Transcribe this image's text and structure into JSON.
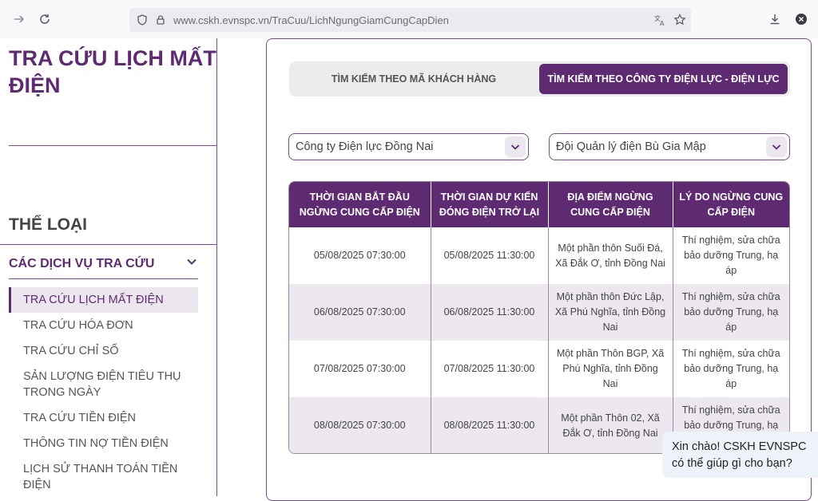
{
  "browser": {
    "url": "www.cskh.evnspc.vn/TraCuu/LichNgungGiamCungCapDien"
  },
  "page": {
    "title": "TRA CỨU LỊCH MẤT ĐIỆN",
    "category_title": "THỂ LOẠI",
    "services_title": "CÁC DỊCH VỤ TRA CỨU"
  },
  "menu": {
    "items": [
      {
        "label": "TRA CỨU LỊCH MẤT ĐIỆN",
        "active": true
      },
      {
        "label": "TRA CỨU HÓA ĐƠN"
      },
      {
        "label": "TRA CỨU CHỈ SỐ"
      },
      {
        "label": "SẢN LƯỢNG ĐIỆN TIÊU THỤ TRONG NGÀY"
      },
      {
        "label": "TRA CỨU TIỀN ĐIỆN"
      },
      {
        "label": "THÔNG TIN NỢ TIỀN ĐIỆN"
      },
      {
        "label": "LỊCH SỬ THANH TOÁN TIỀN ĐIỆN"
      }
    ]
  },
  "tabs": {
    "by_customer": "TÌM KIẾM THEO MÃ KHÁCH HÀNG",
    "by_company": "TÌM KIẾM THEO CÔNG TY ĐIỆN LỰC - ĐIỆN LỰC"
  },
  "filters": {
    "company": "Công ty Điện lực Đồng Nai",
    "unit": "Đội Quản lý điện Bù Gia Mập"
  },
  "table": {
    "headers": [
      "THỜI GIAN BẮT ĐẦU NGỪNG CUNG CẤP ĐIỆN",
      "THỜI GIAN DỰ KIẾN ĐÓNG ĐIỆN TRỞ LẠI",
      "ĐỊA ĐIỂM NGỪNG CUNG CẤP ĐIỆN",
      "LÝ DO NGỪNG CUNG CẤP ĐIỆN"
    ],
    "rows": [
      [
        "05/08/2025 07:30:00",
        "05/08/2025 11:30:00",
        "Một phần thôn Suối Đá, Xã Đắk Ơ, tỉnh Đồng Nai",
        "Thí nghiệm, sửa chữa bảo dưỡng Trung, hạ áp"
      ],
      [
        "06/08/2025 07:30:00",
        "06/08/2025 11:30:00",
        "Một phần thôn Đức Lập, Xã Phú Nghĩa, tỉnh Đồng Nai",
        "Thí nghiệm, sửa chữa bảo dưỡng Trung, hạ áp"
      ],
      [
        "07/08/2025 07:30:00",
        "07/08/2025 11:30:00",
        "Một phần Thôn BGP, Xã Phú Nghĩa, tỉnh Đồng Nai",
        "Thí nghiệm, sửa chữa bảo dưỡng Trung, hạ áp"
      ],
      [
        "08/08/2025 07:30:00",
        "08/08/2025 11:30:00",
        "Một phần Thôn 02, Xã Đắk Ơ, tỉnh Đồng Nai",
        "Thí nghiệm, sửa chữa bảo dưỡng Trung, hạ áp"
      ]
    ]
  },
  "chat": {
    "message": "Xin chào! CSKH EVNSPC có thể giúp gì cho bạn?"
  },
  "colors": {
    "brand_purple": "#5e2a72",
    "row_alt": "#ede8ef"
  }
}
